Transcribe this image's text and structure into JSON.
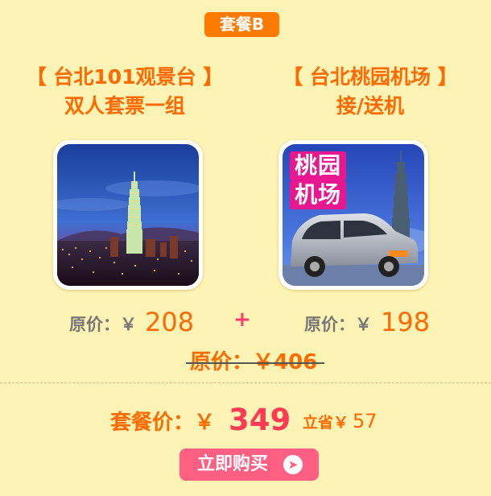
{
  "package": {
    "badge": "套餐B"
  },
  "items": [
    {
      "title_line1": "【 台北101观景台 】",
      "title_line2": "双人套票一组",
      "price_label": "原价：￥",
      "price": "208"
    },
    {
      "title_line1": "【 台北桃园机场 】",
      "title_line2": "接/送机",
      "image_tag_line1": "桃园",
      "image_tag_line2": "机场",
      "price_label": "原价：￥",
      "price": "198"
    }
  ],
  "plus": "+",
  "original_total": "原价：￥406",
  "package_price_label": "套餐价：￥",
  "package_price": "349",
  "savings_label": "立省￥",
  "savings": "57",
  "buy_button": {
    "label": "立即购买",
    "icon": "chevron-right-icon"
  },
  "colors": {
    "background": "#fdf3b4",
    "accent": "#ff6a00",
    "button": "#ff5f82",
    "badge": "#ff7a00"
  }
}
